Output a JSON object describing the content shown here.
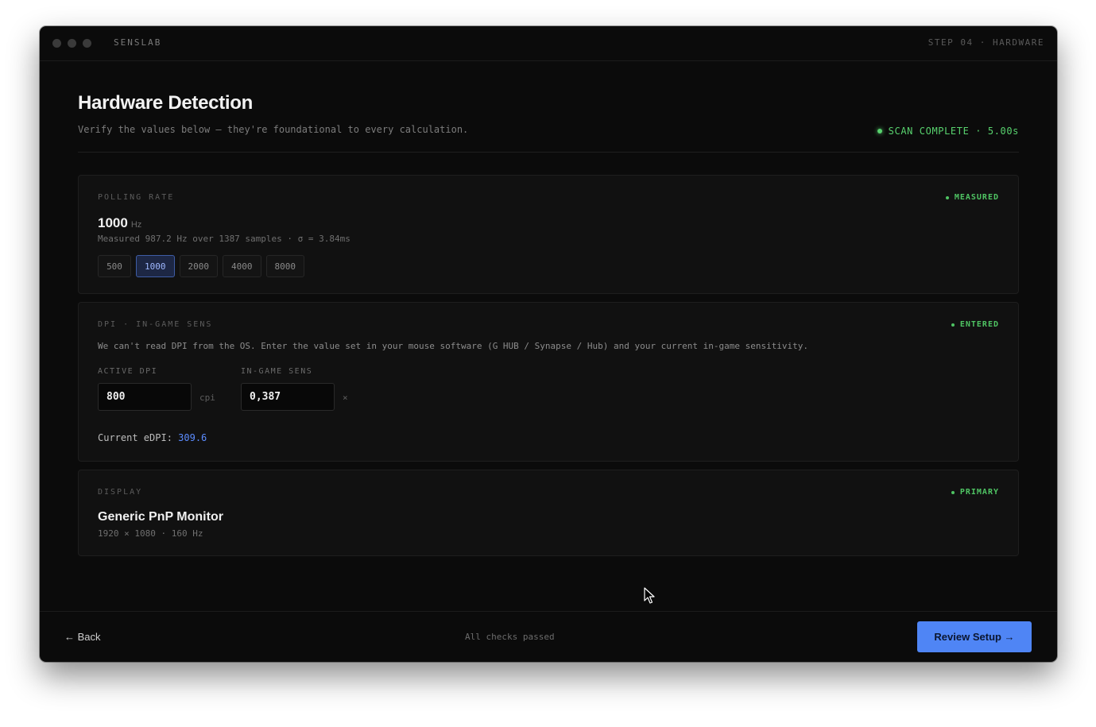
{
  "window": {
    "brand": "SENSLAB",
    "step": "STEP 04 · HARDWARE"
  },
  "header": {
    "title": "Hardware Detection",
    "subtitle": "Verify the values below — they're foundational to every calculation.",
    "scan_status": "SCAN COMPLETE · 5.00s"
  },
  "polling": {
    "label": "POLLING RATE",
    "badge": "MEASURED",
    "value": "1000",
    "unit": "Hz",
    "meta": "Measured 987.2 Hz over 1387 samples · σ = 3.84ms",
    "options": [
      "500",
      "1000",
      "2000",
      "4000",
      "8000"
    ],
    "selected": "1000"
  },
  "dpi": {
    "label": "DPI · IN-GAME SENS",
    "badge": "ENTERED",
    "description": "We can't read DPI from the OS. Enter the value set in your mouse software (G HUB / Synapse / Hub) and your current in-game sensitivity.",
    "dpi_label": "ACTIVE DPI",
    "dpi_value": "800",
    "dpi_suffix": "cpi",
    "sens_label": "IN-GAME SENS",
    "sens_value": "0,387",
    "sens_suffix": "×",
    "edpi_label": "Current eDPI:",
    "edpi_value": "309.6"
  },
  "display": {
    "label": "DISPLAY",
    "badge": "PRIMARY",
    "name": "Generic PnP Monitor",
    "meta": "1920 × 1080 · 160 Hz"
  },
  "footer": {
    "back": "← Back",
    "status": "All checks passed",
    "next": "Review Setup →"
  },
  "colors": {
    "accent": "#4f85f5",
    "success": "#58d26e",
    "background": "#0b0b0b"
  }
}
